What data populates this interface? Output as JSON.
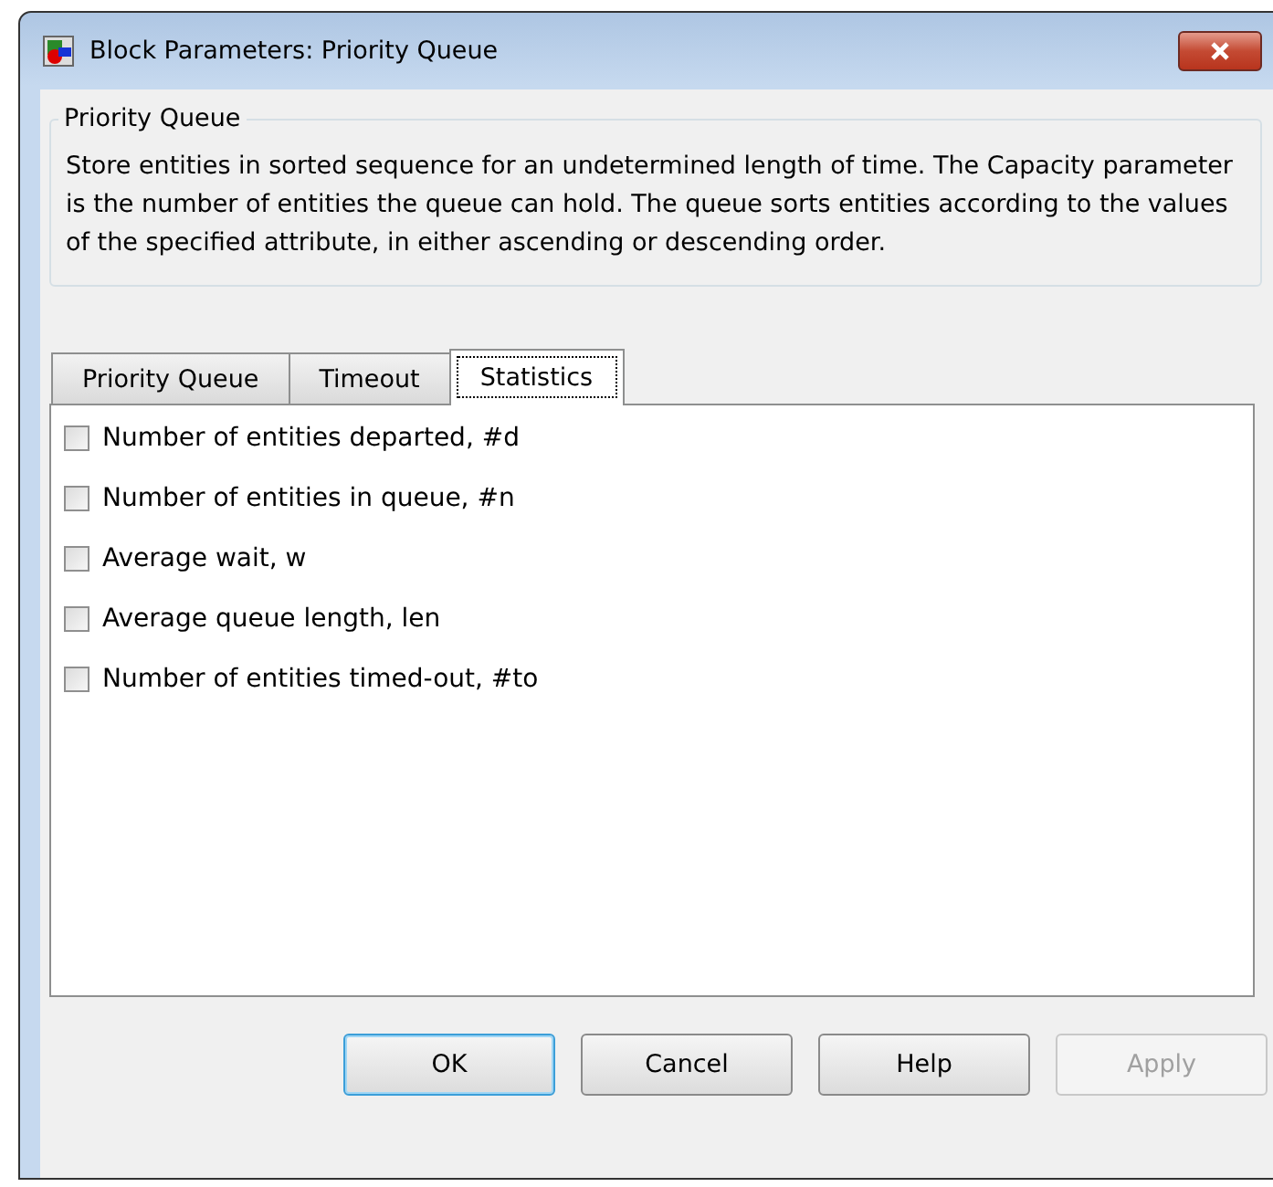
{
  "window": {
    "title": "Block Parameters: Priority Queue"
  },
  "group": {
    "title": "Priority Queue",
    "description": "Store entities in sorted sequence for an undetermined length of time. The Capacity parameter is the number of entities the queue can hold. The queue sorts entities according to the values of the specified attribute, in either ascending or descending order."
  },
  "tabs": [
    {
      "label": "Priority Queue",
      "selected": false
    },
    {
      "label": "Timeout",
      "selected": false
    },
    {
      "label": "Statistics",
      "selected": true
    }
  ],
  "options": [
    {
      "label": "Number of entities departed, #d",
      "checked": false
    },
    {
      "label": "Number of entities in queue, #n",
      "checked": false
    },
    {
      "label": "Average wait, w",
      "checked": false
    },
    {
      "label": "Average queue length, len",
      "checked": false
    },
    {
      "label": "Number of entities timed-out, #to",
      "checked": false
    }
  ],
  "buttons": [
    {
      "label": "OK",
      "default": true,
      "disabled": false
    },
    {
      "label": "Cancel",
      "default": false,
      "disabled": false
    },
    {
      "label": "Help",
      "default": false,
      "disabled": false
    },
    {
      "label": "Apply",
      "default": false,
      "disabled": true
    }
  ]
}
